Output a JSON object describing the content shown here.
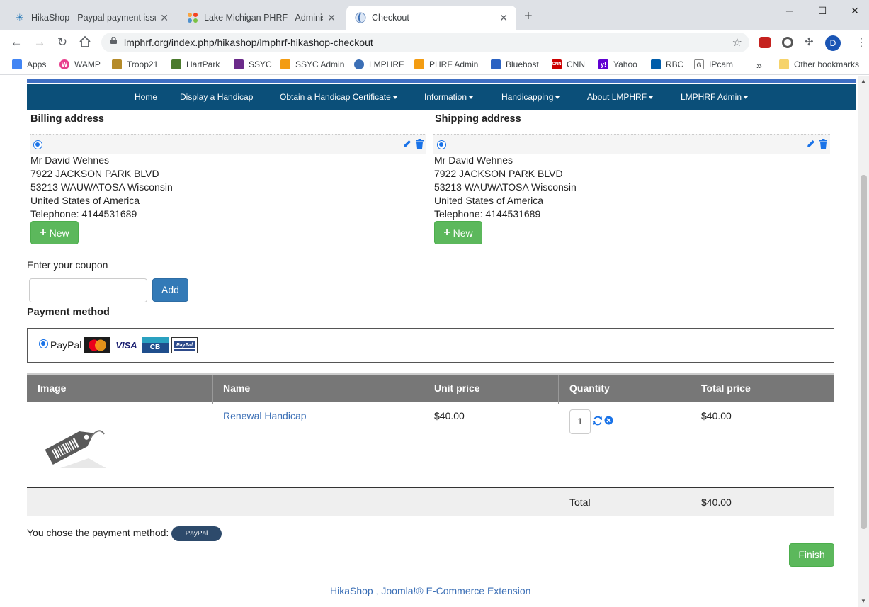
{
  "browser": {
    "tabs": [
      {
        "title": "HikaShop - Paypal payment issue",
        "icon": "hikashop-icon"
      },
      {
        "title": "Lake Michigan PHRF - Administra",
        "icon": "joomla-icon"
      },
      {
        "title": "Checkout",
        "icon": "site-icon"
      }
    ],
    "new_tab": "+",
    "window_controls": {
      "minimize": "─",
      "maximize": "☐",
      "close": "✕"
    },
    "url": "lmphrf.org/index.php/hikashop/lmphrf-hikashop-checkout",
    "profile_initial": "D",
    "bookmarks": [
      {
        "label": "Apps",
        "icon": "apps-grid-icon",
        "color": "#4285f4"
      },
      {
        "label": "WAMP",
        "icon": "wamp-icon",
        "color": "#e83e8c"
      },
      {
        "label": "Troop21",
        "icon": "scouts-icon",
        "color": "#b58b2a"
      },
      {
        "label": "HartPark",
        "icon": "hartpark-icon",
        "color": "#4a7a2c"
      },
      {
        "label": "SSYC",
        "icon": "ssyc-icon",
        "color": "#6b2a8a"
      },
      {
        "label": "SSYC Admin",
        "icon": "joomla-icon",
        "color": "#f39c12"
      },
      {
        "label": "LMPHRF",
        "icon": "lmphrf-icon",
        "color": "#3b6fb6"
      },
      {
        "label": "PHRF Admin",
        "icon": "joomla-icon",
        "color": "#f39c12"
      },
      {
        "label": "Bluehost",
        "icon": "bluehost-icon",
        "color": "#2b62c2"
      },
      {
        "label": "CNN",
        "icon": "cnn-icon",
        "color": "#cc0000"
      },
      {
        "label": "Yahoo",
        "icon": "yahoo-icon",
        "color": "#6001d2"
      },
      {
        "label": "RBC",
        "icon": "rbc-icon",
        "color": "#005daa"
      },
      {
        "label": "IPcam",
        "icon": "google-icon",
        "color": "#888888"
      }
    ],
    "bookmarks_overflow": "»",
    "other_bookmarks": "Other bookmarks"
  },
  "nav": {
    "items": [
      {
        "label": "Home",
        "dropdown": false
      },
      {
        "label": "Display a Handicap",
        "dropdown": false
      },
      {
        "label": "Obtain a Handicap Certificate",
        "dropdown": true
      },
      {
        "label": "Information",
        "dropdown": true
      },
      {
        "label": "Handicapping",
        "dropdown": true
      },
      {
        "label": "About LMPHRF",
        "dropdown": true
      },
      {
        "label": "LMPHRF Admin",
        "dropdown": true
      }
    ]
  },
  "billing": {
    "title": "Billing address",
    "lines": [
      "Mr David Wehnes",
      "7922 JACKSON PARK BLVD",
      "53213 WAUWATOSA Wisconsin",
      "United States of America",
      "Telephone: 4144531689"
    ],
    "new_label": "New"
  },
  "shipping": {
    "title": "Shipping address",
    "lines": [
      "Mr David Wehnes",
      "7922 JACKSON PARK BLVD",
      "53213 WAUWATOSA Wisconsin",
      "United States of America",
      "Telephone: 4144531689"
    ],
    "new_label": "New"
  },
  "coupon": {
    "label": "Enter your coupon",
    "value": "",
    "add_label": "Add"
  },
  "payment": {
    "title": "Payment method",
    "option": "PayPal",
    "cards": [
      "MasterCard",
      "VISA",
      "CB",
      "PayPal"
    ]
  },
  "cart": {
    "headers": [
      "Image",
      "Name",
      "Unit price",
      "Quantity",
      "Total price"
    ],
    "rows": [
      {
        "name": "Renewal Handicap",
        "unit_price": "$40.00",
        "quantity": "1",
        "total_price": "$40.00"
      }
    ],
    "total_label": "Total",
    "total_value": "$40.00"
  },
  "chosen": {
    "text": "You chose the payment method:",
    "method": "PayPal"
  },
  "finish_label": "Finish",
  "footer": "HikaShop , Joomla!® E-Commerce Extension",
  "colors": {
    "nav_bg": "#0b4f79",
    "green": "#5cb85c",
    "blue_btn": "#337ab7",
    "table_head": "#777777"
  }
}
